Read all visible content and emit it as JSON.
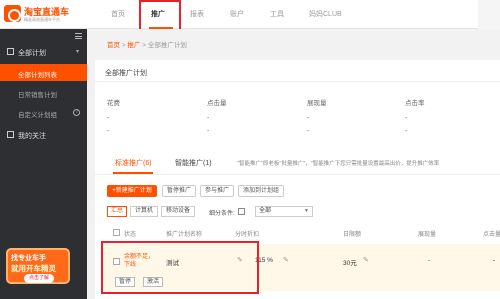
{
  "brand": {
    "title": "淘宝直通车",
    "subtitle": "精准高效直通车平台"
  },
  "nav": {
    "items": [
      "首页",
      "推广",
      "报表",
      "账户",
      "工具",
      "妈妈CLUB"
    ],
    "active_index": 1
  },
  "sidebar": {
    "group_label": "全部计划",
    "items": [
      {
        "label": "全部计划列表"
      },
      {
        "label": "日常销售计划"
      },
      {
        "label": "自定义计划组"
      }
    ],
    "favorites_label": "我的关注",
    "promo": {
      "line1": "找专业车手",
      "line2": "就用开车精灵",
      "button": "点击了解"
    }
  },
  "breadcrumb": {
    "home": "首页",
    "sep1": ">",
    "level2": "推广",
    "sep2": ">",
    "current": "全部推广计划"
  },
  "summary": {
    "title": "全部推广计划",
    "metrics": [
      {
        "label": "花费",
        "value1": "-",
        "value2": "-"
      },
      {
        "label": "点击量",
        "value1": "-",
        "value2": "-"
      },
      {
        "label": "展现量",
        "value1": "-",
        "value2": "-"
      },
      {
        "label": "点击率",
        "value1": "-",
        "value2": "-"
      }
    ]
  },
  "campaigns": {
    "tabs": [
      "标准推广(6)",
      "智能推广(1)"
    ],
    "note": "\"智能推广\"即老板\"批量推广\"，\"智能推广下您只需批量设置最高出价，提升推广效率",
    "buttons": [
      "+新建推广计划",
      "暂停推广",
      "参与推广",
      "添加到计划组"
    ],
    "segments": [
      "汇总",
      "计算机",
      "移动设备"
    ],
    "filter_label": "细分条件:",
    "filter_value": "全部",
    "columns": [
      "状态",
      "推广计划名称",
      "分时折扣",
      "日限额",
      "展现量",
      "点击量"
    ],
    "row": {
      "status": "余额不足，下线",
      "name": "测试",
      "discount": "115 %",
      "budget": "30元",
      "impressions": "-",
      "clicks": "-",
      "actions": [
        "暂停",
        "激活"
      ]
    }
  },
  "colors": {
    "accent": "#ff5000",
    "sidebar_bg": "#2e2f33",
    "highlight_border": "#e8212b"
  }
}
